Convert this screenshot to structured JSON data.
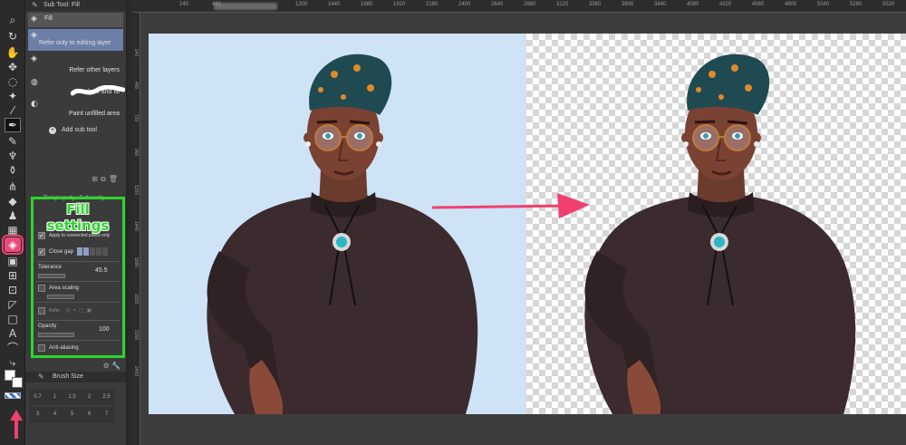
{
  "subtool": {
    "header": "Sub Tool: Fill",
    "items": [
      {
        "label": "Fill",
        "icon": "fill-bucket-icon"
      },
      {
        "label": "Refer only to editing layer",
        "icon": "fill-bucket-icon"
      },
      {
        "label": "Refer other layers",
        "icon": "fill-bucket-icon"
      },
      {
        "label": "Enclose and fill",
        "icon": "lasso-fill-icon"
      },
      {
        "label": "Paint unfilled area",
        "icon": "brush-fill-icon"
      }
    ],
    "add_label": "Add sub tool"
  },
  "toolprop": {
    "header": "Tool property : Refer only",
    "callout": "Fill settings",
    "apply_connected": "Apply to connected pixels only",
    "close_gap": "Close gap",
    "tolerance_label": "Tolerance",
    "tolerance_value": "45.5",
    "area_scaling": "Area scaling",
    "refer_label": "Refer",
    "opacity_label": "Opacity",
    "opacity_value": "100",
    "anti_aliasing": "Anti-aliasing"
  },
  "brush": {
    "header": "Brush Size",
    "sizes": [
      "0.7",
      "1",
      "1.5",
      "2",
      "2.5",
      "3",
      "4",
      "5",
      "6",
      "7",
      "",
      "",
      "",
      "",
      ""
    ]
  },
  "ruler": {
    "top": [
      "240",
      "480",
      "720",
      "960",
      "1200",
      "1440",
      "1680",
      "1920",
      "2160",
      "2400",
      "2640",
      "2880",
      "3120",
      "3360",
      "3600",
      "3840",
      "4080",
      "4320",
      "4560",
      "4800",
      "5040",
      "5280",
      "5520"
    ],
    "left": [
      "240",
      "480",
      "720",
      "960",
      "1200",
      "1440",
      "1680",
      "1920",
      "2160",
      "2400"
    ]
  },
  "colors": {
    "highlight_green": "#2bd62b",
    "arrow_pink": "#f0406e",
    "canvas_blue": "#cfe3f7",
    "selected_item": "#6c7fa8"
  }
}
